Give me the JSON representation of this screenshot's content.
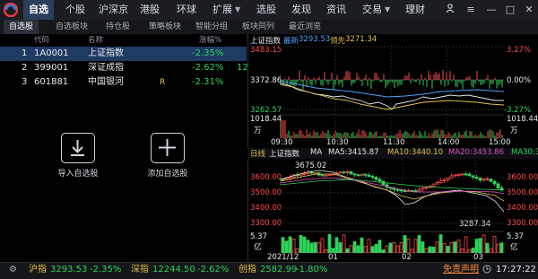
{
  "topnav": {
    "items": [
      "自选",
      "个股",
      "沪深京",
      "港股",
      "环球",
      "扩展",
      "选股",
      "发现",
      "资讯",
      "交易",
      "理财"
    ],
    "active_index": 0,
    "icons": [
      "user-icon",
      "menu-icon",
      "minimize-icon",
      "maximize-icon",
      "close-icon"
    ]
  },
  "subtabs": {
    "items": [
      "自选股",
      "自选板块",
      "持仓股",
      "策略板块",
      "智能分组",
      "板块同列",
      "最近浏览"
    ],
    "active_index": 0
  },
  "watchlist": {
    "headers": {
      "code": "代码",
      "name": "名称",
      "change": "涨幅%"
    },
    "rows": [
      {
        "num": "1",
        "code": "1A0001",
        "name": "上证指数",
        "flag": "",
        "change": "-2.35%",
        "extra": ""
      },
      {
        "num": "2",
        "code": "399001",
        "name": "深证成指",
        "flag": "",
        "change": "-2.62%",
        "extra": "12"
      },
      {
        "num": "3",
        "code": "601881",
        "name": "中国银河",
        "flag": "R",
        "change": "-2.31%",
        "extra": ""
      }
    ],
    "selected_row": 0,
    "buttons": [
      {
        "label": "导入自选股",
        "icon": "import-icon"
      },
      {
        "label": "添加自选股",
        "icon": "add-icon"
      }
    ]
  },
  "intraday": {
    "title": "上证指数",
    "latest_label": "最新",
    "latest": "3293.53",
    "lead_label": "领先",
    "lead": "3271.34",
    "price_high": "3483.15",
    "price_mid": "3372.86",
    "price_low": "3262.57",
    "pct_high": "3.27%",
    "pct_mid": "0.00%",
    "pct_low": "-3.27%",
    "vol_top": "1018.44",
    "vol_unit": "万",
    "vol_top_r": "1018.44",
    "vol_unit_r": "万",
    "time_ticks": [
      "09:30",
      "10:30",
      "11:30",
      "14:00",
      "15:00"
    ]
  },
  "daily": {
    "period": "日线",
    "title": "上证指数",
    "ma_label": "MA",
    "ma5": "MA5:3415.87",
    "ma10": "MA10:3440.10",
    "ma20": "MA20:3453.86",
    "ma30": "MA30:3",
    "price_ticks": [
      "3600.00",
      "3500.00",
      "3400.00",
      "3300.00"
    ],
    "price_ticks_r": [
      "3600.00",
      "3500.00",
      "3400.00",
      "3300.00"
    ],
    "high_label": "3675.02",
    "low_label": "3287.34",
    "vol_top": "5.37",
    "vol_unit": "亿",
    "vol_top_r": "5.37",
    "vol_unit_r": "亿",
    "date_ticks": [
      "2021/12",
      "01",
      "02",
      "03"
    ]
  },
  "statusbar": {
    "items": [
      {
        "name": "沪指",
        "value": "3293.53",
        "change": "-2.35%"
      },
      {
        "name": "深指",
        "value": "12244.50",
        "change": "-2.62%"
      },
      {
        "name": "创指",
        "value": "2582.99",
        "change": "-1.80%"
      }
    ],
    "disclaimer": "免责声明",
    "time": "17:27:22"
  },
  "colors": {
    "up": "#ff4b4b",
    "down": "#2fd35a",
    "accent": "#1f3a63",
    "lead": "#e8c24a"
  }
}
